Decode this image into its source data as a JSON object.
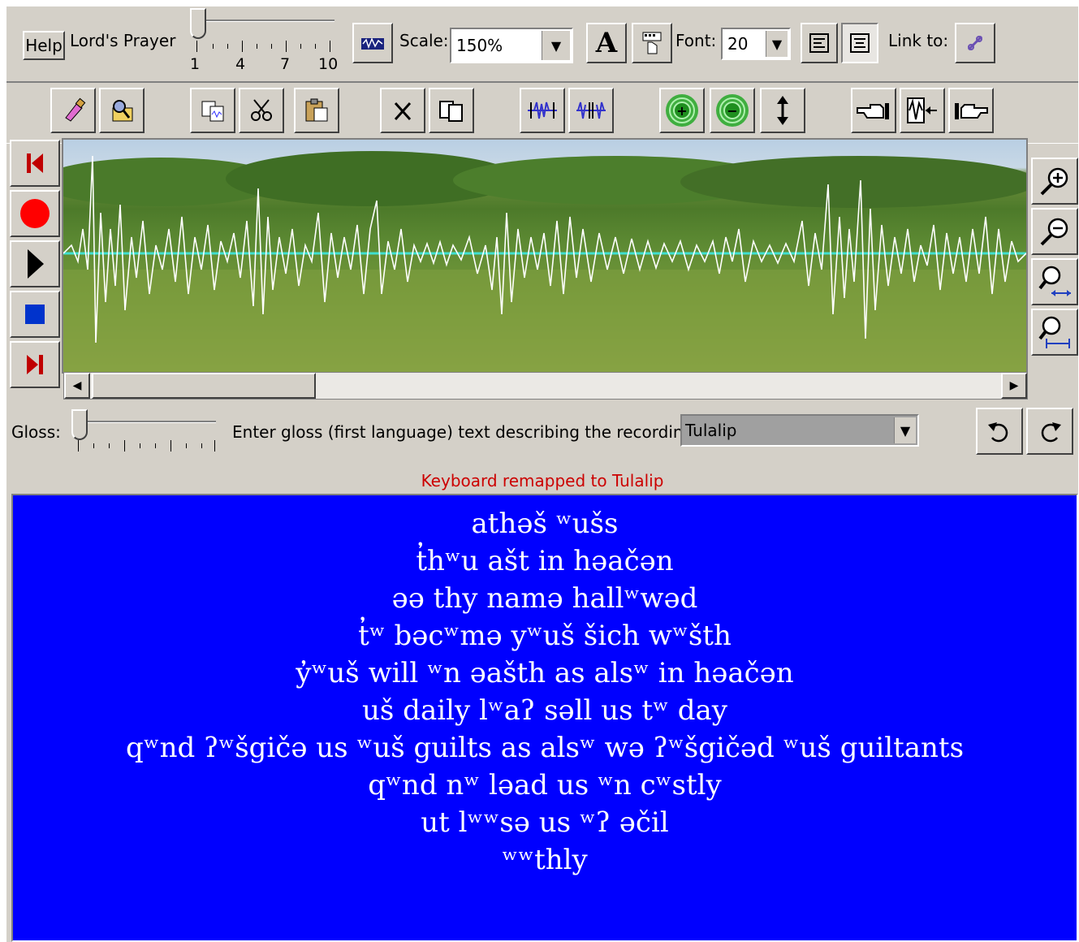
{
  "top_toolbar": {
    "help_label": "Help",
    "title": "Lord's Prayer",
    "ruler_labels": [
      "1",
      "4",
      "7",
      "10"
    ],
    "scale_label": "Scale:",
    "scale_value": "150%",
    "font_label": "Font:",
    "font_value": "20",
    "link_label": "Link to:"
  },
  "gloss": {
    "label": "Gloss:",
    "prompt": "Enter gloss (first language) text describing the recording",
    "language_value": "Tulalip"
  },
  "status": {
    "message": "Keyboard remapped to Tulalip",
    "color": "#cc0000"
  },
  "transcript_lines": [
    "athəš ʷušs",
    "t̓hʷu ašt in həačən",
    "əə thy namə hallʷwəd",
    "t̓ʷ bəcʷmə yʷuš šich wʷšth",
    "y̓ʷuš will ʷn əašth as alsʷ in həačən",
    "uš daily lʷaʔ səll us tʷ day",
    "qʷnd ʔʷšgičə us ʷuš guilts as alsʷ wə ʔʷšgičəd ʷuš guiltants",
    "qʷnd nʷ ləad us ʷn cʷstly",
    "ut lʷʷsə us ʷʔ əčil",
    "ʷʷthly"
  ],
  "colors": {
    "window": "#d4d0c8",
    "text_area": "#0000ff",
    "text": "#ffffff",
    "waveform": "#ffffff",
    "baseline": "#40e0d0"
  },
  "icons": {
    "toolbar": [
      "eraser-icon",
      "search-folder-icon",
      "copy-icon",
      "cut-icon",
      "paste-icon",
      "delete-icon",
      "duplicate-icon",
      "compress-icon",
      "expand-icon",
      "zoom-in-green-icon",
      "zoom-out-green-icon",
      "vertical-resize-icon",
      "hand-left-icon",
      "wave-insert-icon",
      "hand-right-icon"
    ],
    "transport": [
      "skip-start-icon",
      "record-icon",
      "play-icon",
      "stop-icon",
      "skip-end-icon"
    ],
    "zoom": [
      "zoom-in-icon",
      "zoom-out-icon",
      "zoom-fit-horizontal-icon",
      "zoom-range-icon"
    ]
  }
}
